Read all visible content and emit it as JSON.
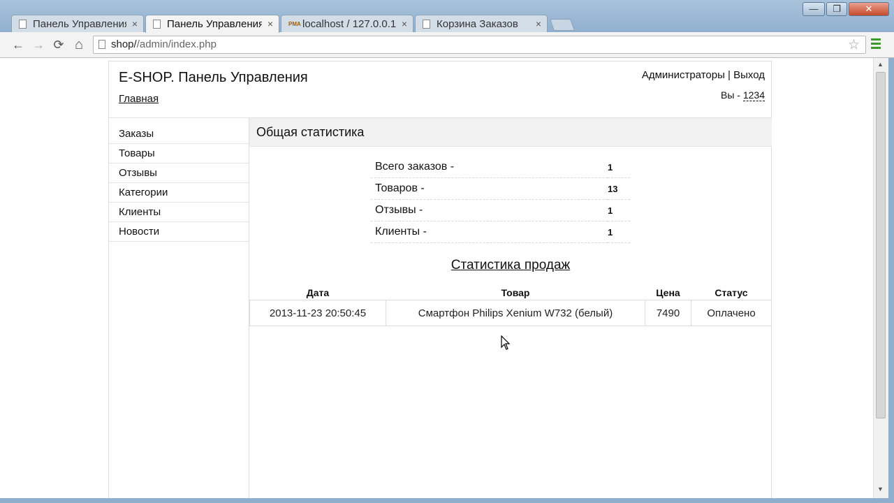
{
  "browser": {
    "tabs": [
      {
        "title": "Панель Управления",
        "icon": "page-icon",
        "active": false
      },
      {
        "title": "Панель Управления",
        "icon": "page-icon",
        "active": true
      },
      {
        "title": "localhost / 127.0.0.1",
        "icon": "phpmyadmin-icon",
        "active": false
      },
      {
        "title": "Корзина Заказов",
        "icon": "page-icon",
        "active": false
      }
    ],
    "tab_close_glyph": "×",
    "pma_glyph": "PMA",
    "url": {
      "host": "shop/",
      "path": "/admin/index.php"
    },
    "window_buttons": {
      "minimize": "—",
      "maximize": "❐",
      "close": "✕"
    },
    "nav_glyphs": {
      "back": "←",
      "forward": "→",
      "reload": "⟳",
      "home": "⌂",
      "star": "☆"
    }
  },
  "header": {
    "site_title": "E-SHOP. Панель Управления",
    "home_link": "Главная",
    "admin_link": "Администраторы",
    "separator": " | ",
    "logout_link": "Выход",
    "you_prefix": "Вы - ",
    "user_login": "1234"
  },
  "sidebar": {
    "items": [
      "Заказы",
      "Товары",
      "Отзывы",
      "Категории",
      "Клиенты",
      "Новости"
    ]
  },
  "stats": {
    "title": "Общая статистика",
    "rows": [
      {
        "label": "Всего заказов -",
        "value": "1"
      },
      {
        "label": "Товаров -",
        "value": "13"
      },
      {
        "label": "Отзывы -",
        "value": "1"
      },
      {
        "label": "Клиенты -",
        "value": "1"
      }
    ]
  },
  "sales": {
    "title": "Статистика продаж",
    "columns": [
      "Дата",
      "Товар",
      "Цена",
      "Статус"
    ],
    "rows": [
      {
        "date": "2013-11-23 20:50:45",
        "product": "Смартфон Philips Xenium W732 (белый)",
        "price": "7490",
        "status": "Оплачено"
      }
    ]
  },
  "colors": {
    "frame": "#8fb0cf",
    "menu_green": "#3c9a2c"
  }
}
